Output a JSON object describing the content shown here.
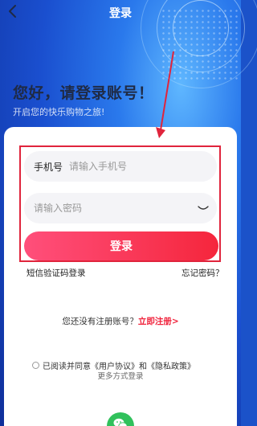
{
  "header": {
    "title": "登录"
  },
  "greeting": {
    "title": "您好，请登录账号！",
    "subtitle": "开启您的快乐购物之旅!"
  },
  "form": {
    "phone_label": "手机号",
    "phone_placeholder": "请输入手机号",
    "password_placeholder": "请输入密码",
    "login_label": "登录"
  },
  "links": {
    "sms_login": "短信验证码登录",
    "forgot_password": "忘记密码？"
  },
  "register": {
    "prompt": "您还没有注册账号？",
    "link": "立即注册>"
  },
  "agreement": {
    "prefix": "已阅读并同意",
    "user_agreement": "《用户协议》",
    "and": "和",
    "privacy_policy": "《隐私政策》"
  },
  "more_login": {
    "label": "更多方式登录",
    "wechat_icon": "wechat-icon"
  },
  "colors": {
    "accent_red": "#f5263c",
    "accent_pink": "#ff4f7b",
    "hero_blue": "#1a4fcf",
    "annotation_red": "#e0243c",
    "wechat_green": "#31c15c"
  }
}
